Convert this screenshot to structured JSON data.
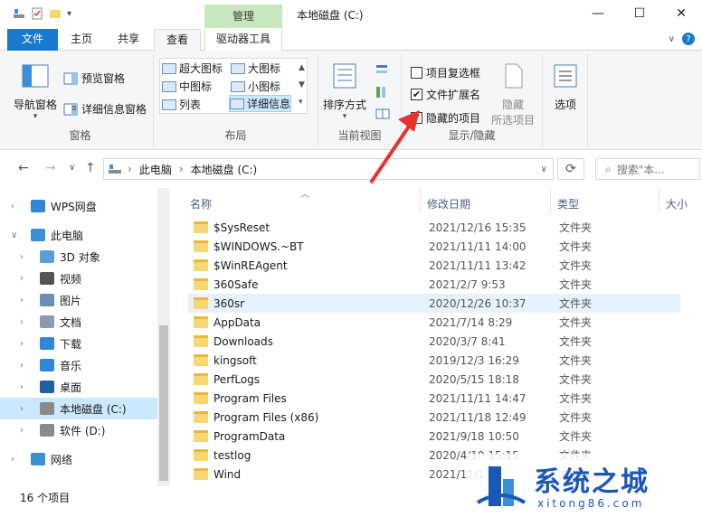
{
  "window": {
    "title": "本地磁盘 (C:)",
    "manage_tab": "管理",
    "min": "—",
    "max": "☐",
    "close": "✕"
  },
  "tabs": {
    "file": "文件",
    "home": "主页",
    "share": "共享",
    "view": "查看",
    "drive_tools": "驱动器工具"
  },
  "ribbon": {
    "panes": {
      "nav_pane": "导航窗格",
      "preview": "预览窗格",
      "details": "详细信息窗格",
      "group": "窗格"
    },
    "layout": {
      "xl_icons": "超大图标",
      "large_icons": "大图标",
      "medium_icons": "中图标",
      "small_icons": "小图标",
      "list": "列表",
      "details": "详细信息",
      "group": "布局"
    },
    "current_view": {
      "sort": "排序方式",
      "group": "当前视图"
    },
    "show_hide": {
      "item_checkbox": "项目复选框",
      "ext": "文件扩展名",
      "hidden": "隐藏的项目",
      "hide": "隐藏",
      "selected": "所选项目",
      "group": "显示/隐藏"
    },
    "options": "选项"
  },
  "address": {
    "this_pc": "此电脑",
    "drive": "本地磁盘 (C:)",
    "search_placeholder": "搜索\"本..."
  },
  "nav": [
    {
      "label": "WPS网盘",
      "icon": "cloud-icon"
    },
    {
      "label": "此电脑",
      "icon": "computer-icon"
    },
    {
      "label": "3D 对象",
      "icon": "cube-icon"
    },
    {
      "label": "视频",
      "icon": "video-icon"
    },
    {
      "label": "图片",
      "icon": "picture-icon"
    },
    {
      "label": "文档",
      "icon": "document-icon"
    },
    {
      "label": "下载",
      "icon": "download-icon"
    },
    {
      "label": "音乐",
      "icon": "music-icon"
    },
    {
      "label": "桌面",
      "icon": "desktop-icon"
    },
    {
      "label": "本地磁盘 (C:)",
      "icon": "drive-icon"
    },
    {
      "label": "软件 (D:)",
      "icon": "drive-icon"
    },
    {
      "label": "网络",
      "icon": "network-icon"
    }
  ],
  "columns": {
    "name": "名称",
    "date": "修改日期",
    "type": "类型",
    "size": "大小"
  },
  "files": [
    {
      "name": "$SysReset",
      "date": "2021/12/16 15:35",
      "type": "文件夹"
    },
    {
      "name": "$WINDOWS.~BT",
      "date": "2021/11/11 14:00",
      "type": "文件夹"
    },
    {
      "name": "$WinREAgent",
      "date": "2021/11/11 13:42",
      "type": "文件夹"
    },
    {
      "name": "360Safe",
      "date": "2021/2/7 9:53",
      "type": "文件夹"
    },
    {
      "name": "360sr",
      "date": "2020/12/26 10:37",
      "type": "文件夹"
    },
    {
      "name": "AppData",
      "date": "2021/7/14 8:29",
      "type": "文件夹"
    },
    {
      "name": "Downloads",
      "date": "2020/3/7 8:41",
      "type": "文件夹"
    },
    {
      "name": "kingsoft",
      "date": "2019/12/3 16:29",
      "type": "文件夹"
    },
    {
      "name": "PerfLogs",
      "date": "2020/5/15 18:18",
      "type": "文件夹"
    },
    {
      "name": "Program Files",
      "date": "2021/11/11 14:47",
      "type": "文件夹"
    },
    {
      "name": "Program Files (x86)",
      "date": "2021/11/18 12:49",
      "type": "文件夹"
    },
    {
      "name": "ProgramData",
      "date": "2021/9/18 10:50",
      "type": "文件夹"
    },
    {
      "name": "testlog",
      "date": "2020/4/10 15:15",
      "type": "文件夹"
    },
    {
      "name": "Wind",
      "date": "2021/11/1",
      "type": "文件夹"
    }
  ],
  "status": {
    "count": "16 个项目"
  },
  "watermark": {
    "title": "系统之城",
    "url": "xitong86.com"
  },
  "colors": {
    "accent": "#1979ca",
    "manage": "#c9e7bf",
    "selection": "#cce8ff",
    "arrow": "#e8322e"
  }
}
